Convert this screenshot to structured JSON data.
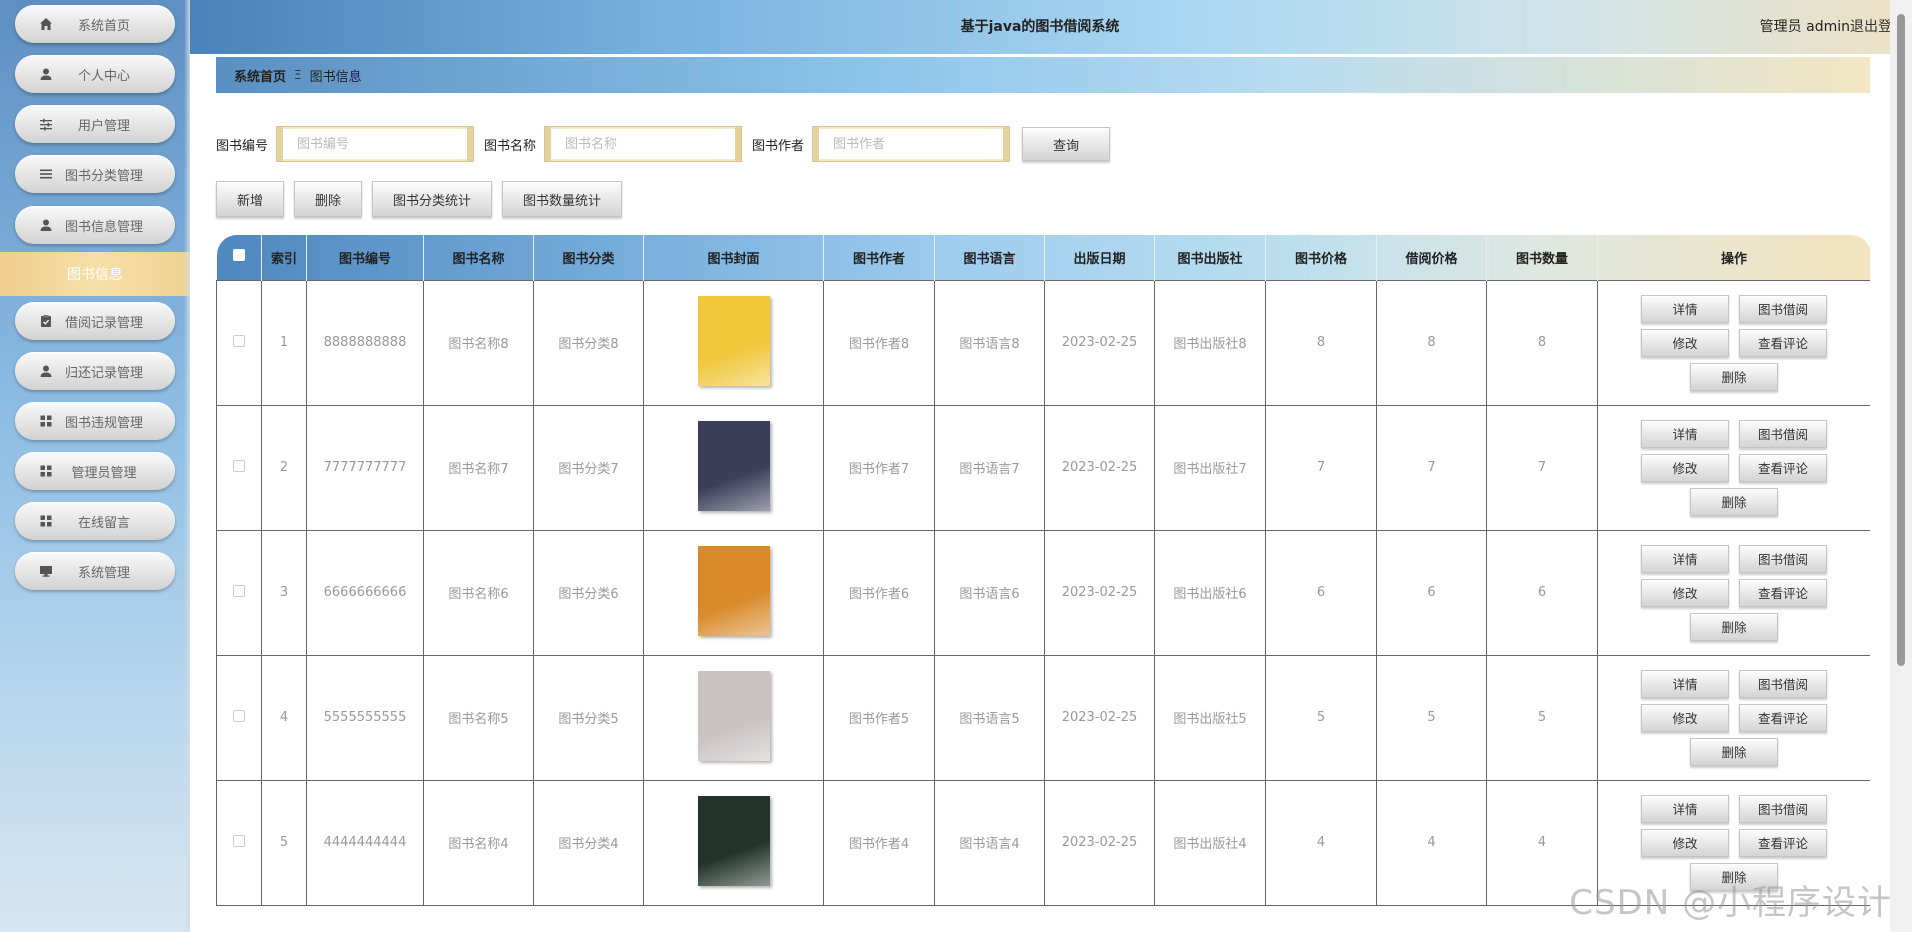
{
  "app": {
    "title": "基于java的图书借阅系统",
    "user_role_text": "管理员 admin",
    "logout": "退出登录"
  },
  "sidebar": {
    "items": [
      {
        "label": "系统首页",
        "icon": "home-icon"
      },
      {
        "label": "个人中心",
        "icon": "person-icon"
      },
      {
        "label": "用户管理",
        "icon": "sliders-icon"
      },
      {
        "label": "图书分类管理",
        "icon": "list-icon"
      },
      {
        "label": "图书信息管理",
        "icon": "person-icon"
      },
      {
        "label": "借阅记录管理",
        "icon": "clipboard-icon"
      },
      {
        "label": "归还记录管理",
        "icon": "person-icon"
      },
      {
        "label": "图书违规管理",
        "icon": "grid-icon"
      },
      {
        "label": "管理员管理",
        "icon": "grid-icon"
      },
      {
        "label": "在线留言",
        "icon": "grid-icon"
      },
      {
        "label": "系统管理",
        "icon": "monitor-icon"
      }
    ],
    "active_sub": "图书信息"
  },
  "breadcrumb": {
    "home": "系统首页",
    "sep": "Ξ",
    "current": "图书信息"
  },
  "search": {
    "code_label": "图书编号",
    "code_placeholder": "图书编号",
    "name_label": "图书名称",
    "name_placeholder": "图书名称",
    "author_label": "图书作者",
    "author_placeholder": "图书作者",
    "query": "查询"
  },
  "actions": {
    "add": "新增",
    "delete": "删除",
    "category_stats": "图书分类统计",
    "quantity_stats": "图书数量统计"
  },
  "table": {
    "headers": [
      "索引",
      "图书编号",
      "图书名称",
      "图书分类",
      "图书封面",
      "图书作者",
      "图书语言",
      "出版日期",
      "图书出版社",
      "图书价格",
      "借阅价格",
      "图书数量",
      "操作"
    ],
    "rows": [
      {
        "index": "1",
        "code": "8888888888",
        "name": "图书名称8",
        "category": "图书分类8",
        "cover_color": "#f1c73c",
        "author": "图书作者8",
        "language": "图书语言8",
        "date": "2023-02-25",
        "publisher": "图书出版社8",
        "price": "8",
        "borrow_price": "8",
        "quantity": "8"
      },
      {
        "index": "2",
        "code": "7777777777",
        "name": "图书名称7",
        "category": "图书分类7",
        "cover_color": "#3b3f5a",
        "author": "图书作者7",
        "language": "图书语言7",
        "date": "2023-02-25",
        "publisher": "图书出版社7",
        "price": "7",
        "borrow_price": "7",
        "quantity": "7"
      },
      {
        "index": "3",
        "code": "6666666666",
        "name": "图书名称6",
        "category": "图书分类6",
        "cover_color": "#d98a2b",
        "author": "图书作者6",
        "language": "图书语言6",
        "date": "2023-02-25",
        "publisher": "图书出版社6",
        "price": "6",
        "borrow_price": "6",
        "quantity": "6"
      },
      {
        "index": "4",
        "code": "5555555555",
        "name": "图书名称5",
        "category": "图书分类5",
        "cover_color": "#c9c3c4",
        "author": "图书作者5",
        "language": "图书语言5",
        "date": "2023-02-25",
        "publisher": "图书出版社5",
        "price": "5",
        "borrow_price": "5",
        "quantity": "5"
      },
      {
        "index": "5",
        "code": "4444444444",
        "name": "图书名称4",
        "category": "图书分类4",
        "cover_color": "#23332c",
        "author": "图书作者4",
        "language": "图书语言4",
        "date": "2023-02-25",
        "publisher": "图书出版社4",
        "price": "4",
        "borrow_price": "4",
        "quantity": "4"
      }
    ],
    "row_ops": {
      "detail": "详情",
      "borrow": "图书借阅",
      "edit": "修改",
      "comments": "查看评论",
      "delete": "删除"
    }
  },
  "watermark": "CSDN @小程序设计"
}
